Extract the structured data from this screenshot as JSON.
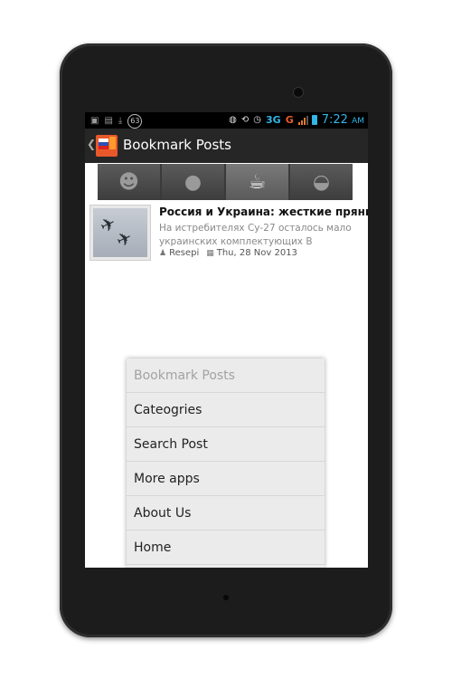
{
  "status_bar": {
    "notification_count": "63",
    "network": "3G",
    "carrier_signal": "G",
    "time": "7:22",
    "ampm": "AM",
    "icons": [
      "image-icon",
      "file-icon",
      "download-icon",
      "globe-icon",
      "rotate-icon",
      "alarm-icon",
      "signal-icon",
      "battery-icon"
    ]
  },
  "action_bar": {
    "title": "Bookmark Posts",
    "app_icon": "flag-book-icon"
  },
  "categories": [
    {
      "name": "man",
      "icon": "person-icon"
    },
    {
      "name": "apple",
      "icon": "apple-icon"
    },
    {
      "name": "cup",
      "icon": "cup-icon"
    },
    {
      "name": "basket",
      "icon": "basket-icon"
    }
  ],
  "post": {
    "title": "Россия и Украина: жесткие пряники",
    "excerpt": "На истребителях Су-27 осталось мало украинских комплектующих В",
    "author": "Resepi",
    "date": "Thu, 28 Nov 2013"
  },
  "menu": {
    "items": [
      {
        "label": "Bookmark Posts",
        "enabled": false
      },
      {
        "label": "Cateogries",
        "enabled": true
      },
      {
        "label": "Search Post",
        "enabled": true
      },
      {
        "label": "More apps",
        "enabled": true
      },
      {
        "label": "About Us",
        "enabled": true
      },
      {
        "label": "Home",
        "enabled": true
      }
    ]
  },
  "colors": {
    "accent": "#33b5e5",
    "action_bar": "#262626",
    "menu_bg": "#ebebeb"
  }
}
